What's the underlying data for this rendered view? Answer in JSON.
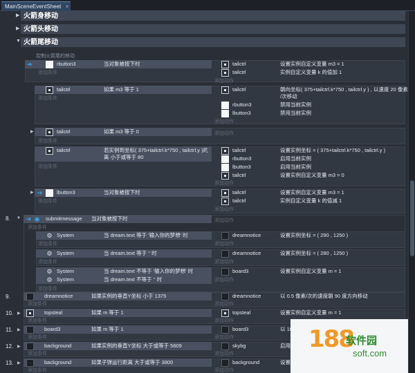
{
  "tab": {
    "title": "MainSceneEventSheet",
    "close": "×"
  },
  "groups": [
    "火箭身移动",
    "火箭头移动",
    "火箭尾移动"
  ],
  "comment": "控制火箭尾的移动",
  "add_condition": "添加条件",
  "add_action": "添加动作",
  "events": [
    {
      "cond": {
        "obj": "rbutton3",
        "text": "当对象被按下时"
      },
      "actions": [
        {
          "obj": "tailctrl",
          "text": "设置实例自定义变量 m3 = 1"
        },
        {
          "obj": "tailctrl",
          "text": "实例自定义变量 k 的值加 1"
        }
      ]
    },
    {
      "cond": {
        "obj": "tailctrl",
        "text": "如果 m3 等于 1"
      },
      "actions": [
        {
          "obj": "tailctrl",
          "text": "朝向坐标( 375+tailctrl.k*750 , tailctrl.y ) , 以速度 20 像素"
        },
        {
          "obj": "",
          "text": "/次移动"
        },
        {
          "obj": "rbutton3",
          "text": "禁用当前实例"
        },
        {
          "obj": "lbutton3",
          "text": "禁用当前实例"
        }
      ]
    },
    {
      "cond": {
        "obj": "tailctrl",
        "text": "如果 m3 等于 0"
      },
      "actions": []
    },
    {
      "cond": {
        "obj": "tailctrl",
        "text": "若实例到坐标( 375+tailctrl.k*750 , tailctrl.y )的距",
        "text2": "离 小于或等于 80"
      },
      "actions": [
        {
          "obj": "tailctrl",
          "text": "设置实例坐标 = ( 375+tailctrl.k*750 , tailctrl.y )"
        },
        {
          "obj": "rbutton3",
          "text": "启用当前实例"
        },
        {
          "obj": "lbutton3",
          "text": "启用当前实例"
        },
        {
          "obj": "tailctrl",
          "text": "设置实例自定义变量 m3 = 0"
        }
      ]
    },
    {
      "cond": {
        "obj": "lbutton3",
        "text": "当对象被按下时"
      },
      "actions": [
        {
          "obj": "tailctrl",
          "text": "设置实例自定义变量 m3 = 1"
        },
        {
          "obj": "tailctrl",
          "text": "实例自定义变量 k 的值减 1"
        }
      ]
    }
  ],
  "e8": {
    "num": "8.",
    "obj": "submitmessage",
    "text": "当对象被按下时",
    "subs": [
      {
        "obj": "System",
        "text": "当 dream.text 等于 '输入你的梦想' 时",
        "aobj": "dreamnotice",
        "atext": "设置实例坐标 = ( 290 , 1250 )"
      },
      {
        "obj": "System",
        "text": "当 dream.text 等于 '' 时",
        "aobj": "dreamnotice",
        "atext": "设置实例坐标 = ( 280 , 1250 )"
      },
      {
        "obj": "System",
        "text": "当 dream.text 不等于 '输入你的梦想' 时",
        "aobj": "board3",
        "atext": "设置实例自定义变量 m = 1"
      },
      {
        "obj": "System",
        "text": "当 dream.text 不等于 '' 时",
        "aobj": "",
        "atext": ""
      }
    ]
  },
  "numbered": [
    {
      "num": "9.",
      "obj": "dreamnotice",
      "text": "如果实例的垂直Y坐标 小于 1375",
      "aobj": "dreamnotice",
      "atext": "以 0.5 像素/次的速度朝 90 度方向移动"
    },
    {
      "num": "10.",
      "obj": "topsteal",
      "text": "如果 m 等于 1",
      "aobj": "topsteal",
      "atext": "设置实例自定义变量 m = 1"
    },
    {
      "num": "11.",
      "obj": "board3",
      "text": "如果 m 等于 1",
      "aobj": "board3",
      "atext": "以 10"
    },
    {
      "num": "12.",
      "obj": "background",
      "text": "如果实例的垂直Y坐标 大于或等于 5609",
      "aobj": "skybg",
      "atext": "启用"
    },
    {
      "num": "13.",
      "obj": "background",
      "text": "如果子弹运行距离 大于或等于 3800",
      "aobj": "background",
      "atext": "设置"
    }
  ],
  "watermark": {
    "num": "188",
    "title": "软件园",
    "site": "soft.com"
  }
}
